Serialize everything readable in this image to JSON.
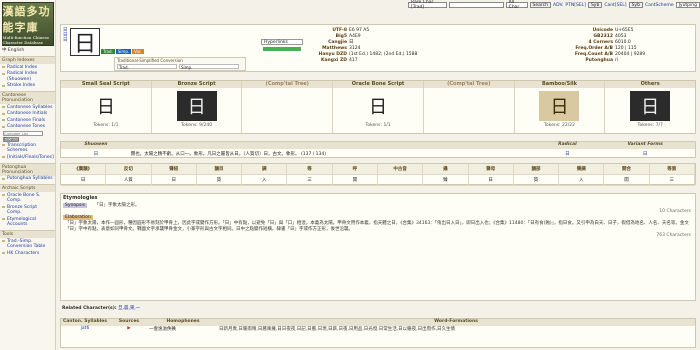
{
  "sidebar": {
    "logo_text": "漢語多功能字庫",
    "logo_sub": "Multi-function Chinese Character Database",
    "lang": "中 English",
    "sections": [
      {
        "title": "Graph Indexes",
        "items": [
          "Radical Index",
          "Radical Index (Shuowen)",
          "Stroke Index"
        ]
      },
      {
        "title": "Cantonese Pronunciation",
        "items": [
          "Cantonese Syllables",
          "Cantonese Initials",
          "Cantonese Finals",
          "Cantonese Tones"
        ]
      },
      {
        "title": "Putonghua Pronunciation",
        "items": [
          "Putonghua Syllables"
        ]
      },
      {
        "title": "Archaic Scripts",
        "items": [
          "Oracle Bone S. Comp.",
          "Bronze Script Comp.",
          "Etymological Accounts"
        ]
      },
      {
        "title": "Tools",
        "items": [
          "Trad.-Simp. Conversion Table",
          "HK Characters"
        ]
      }
    ],
    "compare_placeholder": "Compare List",
    "browse_label": "Browse",
    "transcription": [
      "Transcription Schemes",
      "[Initials/Finals/Tones]"
    ]
  },
  "topbar": {
    "char_select": "Rare Char [Trad]",
    "all_select": "All Char",
    "search_label": "Search",
    "adv_label": "ADV.",
    "ptn_label": "PTN[SEL]",
    "syb_label": "Syb",
    "cant_label": "Cant[SEL]",
    "syb2_label": "Syb",
    "cantscheme_label": "CantScheme",
    "scheme_value": "Jyutping"
  },
  "header": {
    "side_chars": [
      "日",
      "日",
      "日"
    ],
    "main_char": "日",
    "tag_trad": "Trad.",
    "tag_simp": "Simp.",
    "tag_var": "Var.",
    "conv_title": "Traditional-Simplified Conversion",
    "conv_trad": "Trad.",
    "conv_simp": "Simp.",
    "hyperlinks_label": "Hyperlinks",
    "info_mid": [
      {
        "k": "UTF-8",
        "v": "E6 97 A5"
      },
      {
        "k": "Big5",
        "v": "A4E9"
      },
      {
        "k": "Cangjie",
        "v": "日"
      },
      {
        "k": "Matthews",
        "v": "3124"
      },
      {
        "k": "Hanyu DZD",
        "v": "(1st Ed.) 1482; (2nd Ed.) 1588"
      },
      {
        "k": "Kangxi ZD",
        "v": "417"
      }
    ],
    "info_right": [
      {
        "k": "Unicode",
        "v": "U+65E5"
      },
      {
        "k": "GB2312",
        "v": "4053"
      },
      {
        "k": "4 Corners",
        "v": "6010.0"
      },
      {
        "k": "Freq.Order A/B",
        "v": "120 | 115"
      },
      {
        "k": "Freq.Count A/B",
        "v": "20404 | 9289"
      },
      {
        "k": "Putonghua",
        "v": "rì"
      }
    ]
  },
  "scripts": [
    {
      "title": "Small Seal Script",
      "glyph": "日",
      "tokens": "Tokens: 1/1",
      "style": "light"
    },
    {
      "title": "Bronze Script",
      "glyph": "日",
      "tokens": "Tokens: 9/240",
      "style": "dark"
    },
    {
      "title": "(Comp'tal Tree)",
      "glyph": "",
      "tokens": "",
      "style": "light"
    },
    {
      "title": "Oracle Bone Script",
      "glyph": "日",
      "tokens": "Tokens: 1/1",
      "style": "light"
    },
    {
      "title": "(Comp'tal Tree)",
      "glyph": "",
      "tokens": "",
      "style": "light"
    },
    {
      "title": "Bamboo/Silk",
      "glyph": "日",
      "tokens": "Tokens: 22/22",
      "style": "bamboo"
    },
    {
      "title": "Others",
      "glyph": "日",
      "tokens": "Tokens: 7/7",
      "style": "dark"
    }
  ],
  "shuowen": {
    "heads": [
      "Shuowen",
      "Radical",
      "Variant Forms"
    ],
    "char": "日",
    "text": "實也。太陽之精不虧。从口一。象形。凡日之屬皆从日。〔人質切〕日，古文。象形。 (137 / 134)",
    "radical": "日",
    "variant": "日"
  },
  "phon": {
    "row1": [
      "《廣韻》",
      "反切",
      "聲紐",
      "韻目",
      "調",
      "等",
      "呼",
      "中古音",
      "攝",
      "聲母",
      "韻部",
      "聲調",
      "開合",
      "等第"
    ],
    "row2": [
      "日",
      "人質",
      "日",
      "質",
      "入",
      "三",
      "開",
      "",
      "臻",
      "日",
      "質",
      "入",
      "開",
      "三"
    ]
  },
  "etym": {
    "title": "Etymologies",
    "synopsis_tag": "Synopsis",
    "synopsis": "「日」字象太陽之形。",
    "synopsis_count": "10 Characters",
    "elab_tag": "Elaboration",
    "elab": "「日」字象太陽，本作一圓形，種因圓形不易刻於甲骨上，因此字或變作方形。「日」中有點，以避免「日」與「口」相混，本義為太陽。甲骨文用作本義，指天體之日，《合集》34163：「侑出日入日」，即日出入也；《合集》11480：「日有食(蝕)」，指日食。又引申為白天、日子，假借為地名、人名、天名等。金文「日」字中有點，表意如同甲骨文。戰國文字承襲甲骨金文，小篆字形與古文字相同。日中之點變作短橫。隸書「日」字或作方正形，後世沿襲。",
    "elab_count": "763 Characters",
    "related_label": "Related Character(s):",
    "related": "旦,晨,東,一"
  },
  "bottom": {
    "heads": [
      "Canton. Syllables",
      "Sources",
      "Homophones",
      "Word-Formations"
    ],
    "syllable": "jat6",
    "homophones": "一壹逸溢佚軼",
    "words": "日新月異,日暖雨晴,日曆風擁,日日夜夜,日記,日曆,日現,日薪,日夜,日用品,日光燈,日常生活,日以繼夜,日出而作,日久生情"
  }
}
